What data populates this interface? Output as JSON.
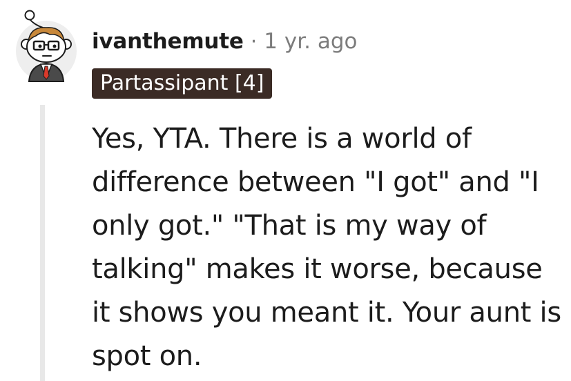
{
  "comment": {
    "author": "ivanthemute",
    "separator": "·",
    "timestamp": "1 yr. ago",
    "flair": "Partassipant [4]",
    "body": "Yes, YTA. There is a world of difference between \"I got\" and \"I only got.\" \"That is my way of talking\" makes it worse, because it shows you meant it. Your aunt is spot on."
  },
  "icons": {
    "avatar": "snoo-avatar-glasses-tie"
  },
  "colors": {
    "flair_background": "#3b2b25",
    "flair_text": "#ffffff",
    "username": "#1c1c1c",
    "meta_gray": "#7c7c7c",
    "thread_line": "#e8e8e8",
    "tie": "#d93a2b"
  }
}
